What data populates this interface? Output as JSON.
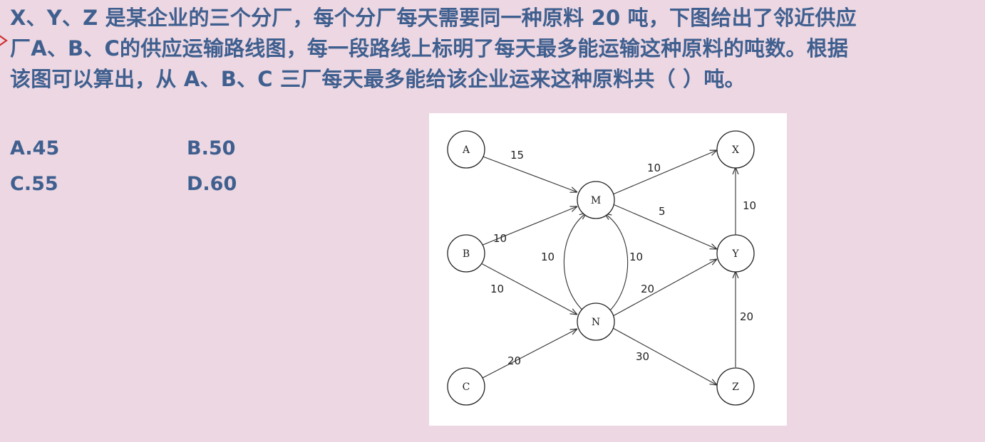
{
  "question": {
    "line1": "X、Y、Z 是某企业的三个分厂，每个分厂每天需要同一种原料 20 吨，下图给出了邻近供应",
    "line2": "厂A、B、C的供应运输路线图，每一段路线上标明了每天最多能运输这种原料的吨数。根据",
    "line3": "该图可以算出，从 A、B、C 三厂每天最多能给该企业运来这种原料共（  ）吨。"
  },
  "options": {
    "a": "A.45",
    "b": "B.50",
    "c": "C.55",
    "d": "D.60"
  },
  "diagram": {
    "nodes": {
      "A": "A",
      "B": "B",
      "C": "C",
      "M": "M",
      "N": "N",
      "X": "X",
      "Y": "Y",
      "Z": "Z"
    },
    "edges": {
      "A_M": "15",
      "B_M": "10",
      "B_N": "10",
      "C_N": "20",
      "M_X": "10",
      "M_Y": "5",
      "N_M": "10",
      "M_N": "10",
      "N_Y": "20",
      "N_Z": "30",
      "Y_X": "10",
      "Z_Y": "20"
    },
    "colors": {
      "text": "#3f5f8f",
      "background": "#ecd7e2"
    }
  }
}
